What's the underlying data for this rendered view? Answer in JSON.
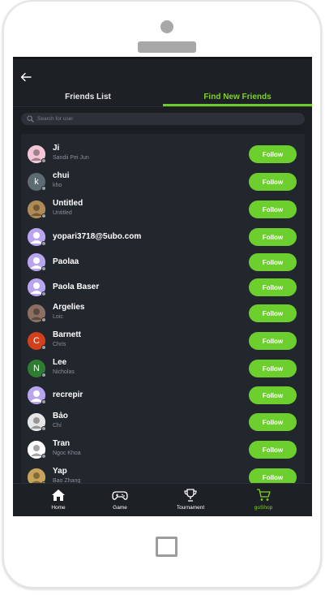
{
  "header": {
    "tabs": [
      {
        "label": "Friends List",
        "active": false
      },
      {
        "label": "Find New Friends",
        "active": true
      }
    ]
  },
  "search": {
    "placeholder": "Search for user"
  },
  "users": [
    {
      "name": "Ji",
      "sub": "Sandii Pei Jun",
      "avatar_letter": "",
      "avatar_color": "#f3c6d6",
      "avatar_kind": "photo-pink"
    },
    {
      "name": "chui",
      "sub": "kho",
      "avatar_letter": "k",
      "avatar_color": "#5d6b73",
      "avatar_kind": "letter"
    },
    {
      "name": "Untitled",
      "sub": "Untitled",
      "avatar_letter": "",
      "avatar_color": "#b08a55",
      "avatar_kind": "photo-food"
    },
    {
      "name": "yopari3718@5ubo.com",
      "sub": "",
      "avatar_letter": "",
      "avatar_color": "#b9a4f0",
      "avatar_kind": "default"
    },
    {
      "name": "Paolaa",
      "sub": "",
      "avatar_letter": "",
      "avatar_color": "#b9a4f0",
      "avatar_kind": "default"
    },
    {
      "name": "Paola Baser",
      "sub": "",
      "avatar_letter": "",
      "avatar_color": "#b9a4f0",
      "avatar_kind": "default"
    },
    {
      "name": "Argelies",
      "sub": "Loic",
      "avatar_letter": "",
      "avatar_color": "#8c6f62",
      "avatar_kind": "photo-group"
    },
    {
      "name": "Barnett",
      "sub": "Chris",
      "avatar_letter": "C",
      "avatar_color": "#d2401c",
      "avatar_kind": "letter"
    },
    {
      "name": "Lee",
      "sub": "Nicholas",
      "avatar_letter": "N",
      "avatar_color": "#2e7d32",
      "avatar_kind": "letter"
    },
    {
      "name": "recrepir",
      "sub": "",
      "avatar_letter": "",
      "avatar_color": "#b9a4f0",
      "avatar_kind": "default"
    },
    {
      "name": "Bảo",
      "sub": "Chí",
      "avatar_letter": "",
      "avatar_color": "#e6e6e6",
      "avatar_kind": "photo-white"
    },
    {
      "name": "Tran",
      "sub": "Ngoc Khoa",
      "avatar_letter": "",
      "avatar_color": "#ffffff",
      "avatar_kind": "photo-bw"
    },
    {
      "name": "Yap",
      "sub": "Bao Zhang",
      "avatar_letter": "",
      "avatar_color": "#c8a35a",
      "avatar_kind": "photo-gold"
    }
  ],
  "follow_label": "Follow",
  "bottom_nav": [
    {
      "label": "Home",
      "icon": "home-icon",
      "active": false
    },
    {
      "label": "Game",
      "icon": "gamepad-icon",
      "active": false
    },
    {
      "label": "Tournament",
      "icon": "trophy-icon",
      "active": false
    },
    {
      "label": "goShop",
      "icon": "cart-icon",
      "active": true
    }
  ],
  "colors": {
    "accent": "#6ccf2e",
    "background": "#1b1e22",
    "panel": "#22262d"
  }
}
